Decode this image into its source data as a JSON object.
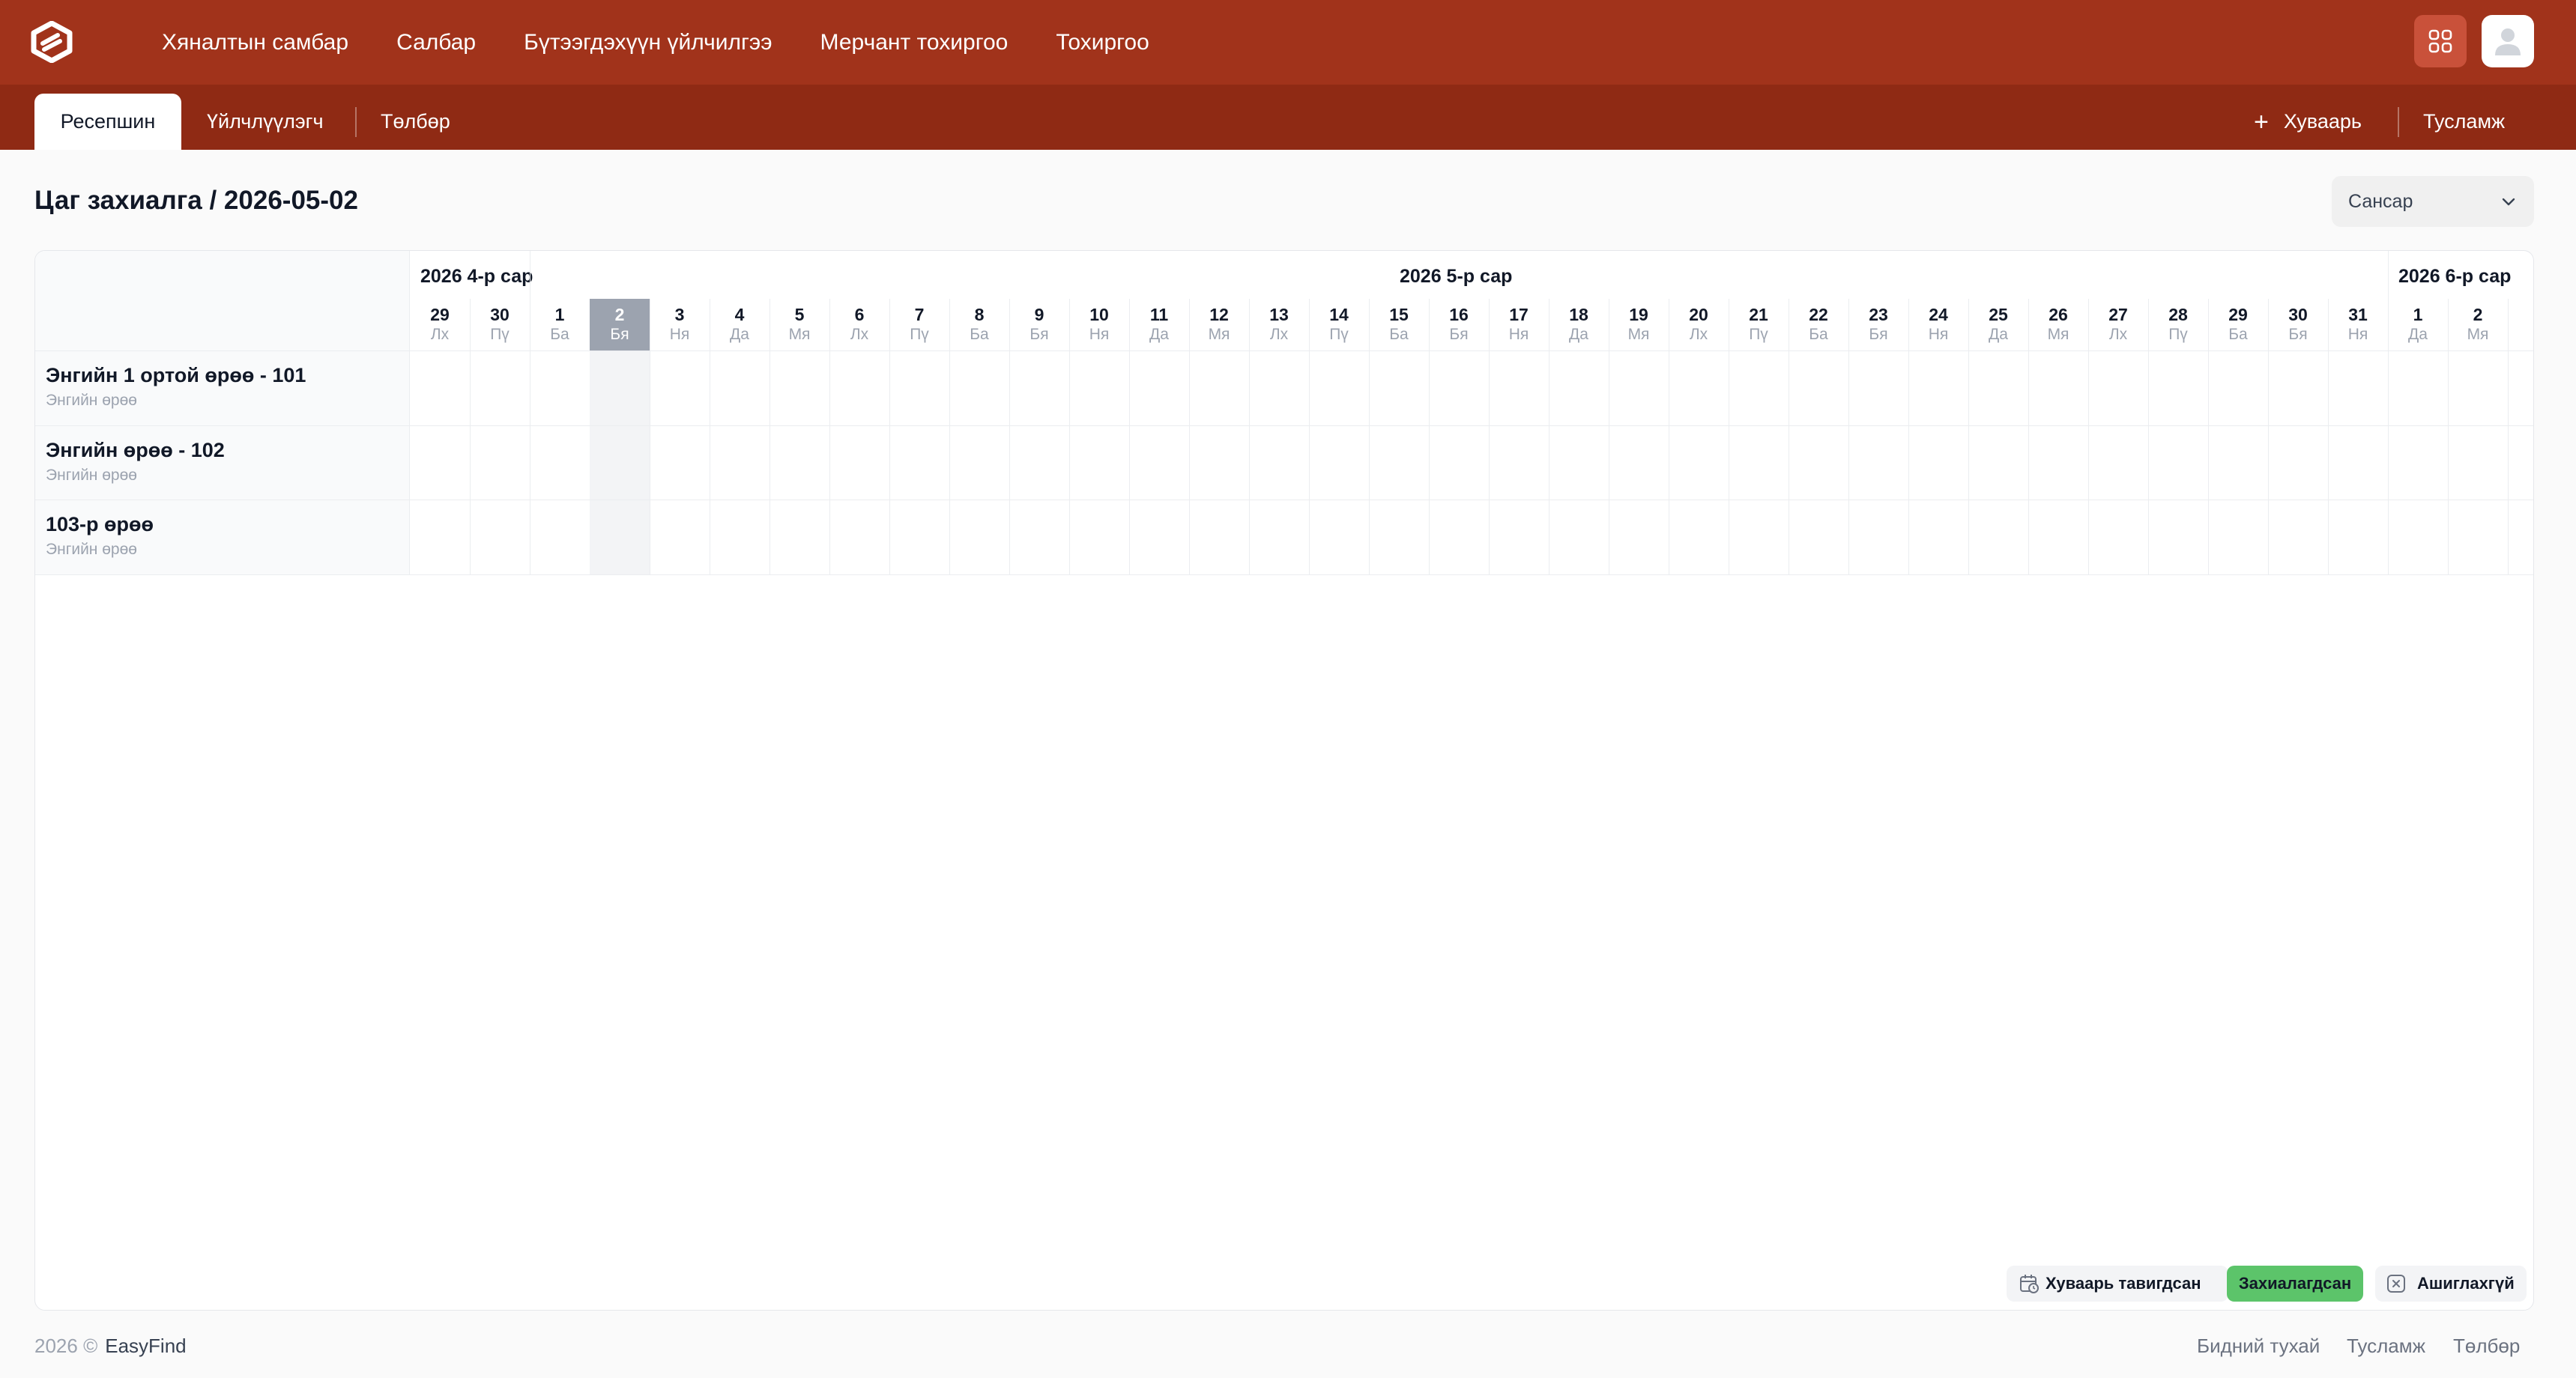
{
  "header": {
    "nav": [
      "Хяналтын самбар",
      "Салбар",
      "Бүтээгдэхүүн үйлчилгээ",
      "Мерчант тохиргоо",
      "Тохиргоо"
    ],
    "brand_color": "#a1331b"
  },
  "subnav": {
    "tabs": [
      "Ресепшин",
      "Үйлчлүүлэгч",
      "Төлбөр"
    ],
    "schedule_label": "Хуваарь",
    "help_label": "Тусламж"
  },
  "page": {
    "title": "Цаг захиалга / 2026-05-02",
    "select_value": "Сансар"
  },
  "calendar": {
    "months": [
      "2026 4-р сар",
      "2026 5-р сар",
      "2026 6-р сар"
    ],
    "days": [
      {
        "d": "29",
        "w": "Лх"
      },
      {
        "d": "30",
        "w": "Пү"
      },
      {
        "d": "1",
        "w": "Ба"
      },
      {
        "d": "2",
        "w": "Бя"
      },
      {
        "d": "3",
        "w": "Ня"
      },
      {
        "d": "4",
        "w": "Да"
      },
      {
        "d": "5",
        "w": "Мя"
      },
      {
        "d": "6",
        "w": "Лх"
      },
      {
        "d": "7",
        "w": "Пү"
      },
      {
        "d": "8",
        "w": "Ба"
      },
      {
        "d": "9",
        "w": "Бя"
      },
      {
        "d": "10",
        "w": "Ня"
      },
      {
        "d": "11",
        "w": "Да"
      },
      {
        "d": "12",
        "w": "Мя"
      },
      {
        "d": "13",
        "w": "Лх"
      },
      {
        "d": "14",
        "w": "Пү"
      },
      {
        "d": "15",
        "w": "Ба"
      },
      {
        "d": "16",
        "w": "Бя"
      },
      {
        "d": "17",
        "w": "Ня"
      },
      {
        "d": "18",
        "w": "Да"
      },
      {
        "d": "19",
        "w": "Мя"
      },
      {
        "d": "20",
        "w": "Лх"
      },
      {
        "d": "21",
        "w": "Пү"
      },
      {
        "d": "22",
        "w": "Ба"
      },
      {
        "d": "23",
        "w": "Бя"
      },
      {
        "d": "24",
        "w": "Ня"
      },
      {
        "d": "25",
        "w": "Да"
      },
      {
        "d": "26",
        "w": "Мя"
      },
      {
        "d": "27",
        "w": "Лх"
      },
      {
        "d": "28",
        "w": "Пү"
      },
      {
        "d": "29",
        "w": "Ба"
      },
      {
        "d": "30",
        "w": "Бя"
      },
      {
        "d": "31",
        "w": "Ня"
      },
      {
        "d": "1",
        "w": "Да"
      },
      {
        "d": "2",
        "w": "Мя"
      }
    ],
    "selected_day": "2",
    "rooms": [
      {
        "name": "Энгийн 1 ортой өрөө - 101",
        "type": "Энгийн өрөө"
      },
      {
        "name": "Энгийн өрөө - 102",
        "type": "Энгийн өрөө"
      },
      {
        "name": "103-р өрөө",
        "type": "Энгийн өрөө"
      }
    ]
  },
  "legend": {
    "scheduled": "Хуваарь тавигдсан",
    "booked": "Захиалагдсан",
    "unused": "Ашиглахгүй",
    "booked_color": "#5cc46a"
  },
  "footer": {
    "copyright": "2026 ©",
    "brand": "EasyFind",
    "links": [
      "Бидний тухай",
      "Тусламж",
      "Төлбөр"
    ]
  }
}
